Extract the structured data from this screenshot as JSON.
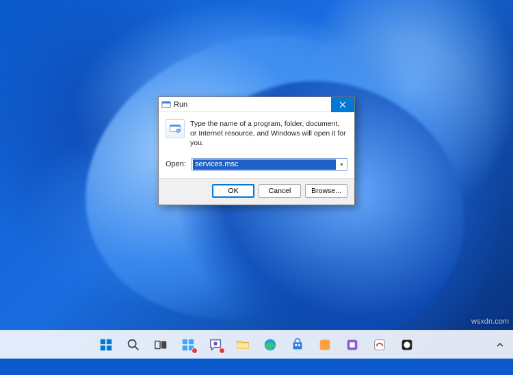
{
  "watermark": "wsxdn.com",
  "run_dialog": {
    "title": "Run",
    "description": "Type the name of a program, folder, document, or Internet resource, and Windows will open it for you.",
    "open_label": "Open:",
    "input_value": "services.msc",
    "buttons": {
      "ok": "OK",
      "cancel": "Cancel",
      "browse": "Browse..."
    }
  },
  "taskbar": {
    "items": [
      {
        "name": "start",
        "icon": "windows"
      },
      {
        "name": "search",
        "icon": "search"
      },
      {
        "name": "task-view",
        "icon": "taskview"
      },
      {
        "name": "widgets",
        "icon": "widgets",
        "badge": true
      },
      {
        "name": "chat",
        "icon": "chat",
        "badge": true
      },
      {
        "name": "file-explorer",
        "icon": "folder"
      },
      {
        "name": "edge",
        "icon": "edge"
      },
      {
        "name": "store",
        "icon": "store"
      },
      {
        "name": "app-1",
        "icon": "generic1"
      },
      {
        "name": "app-2",
        "icon": "generic2"
      },
      {
        "name": "app-3",
        "icon": "generic3"
      },
      {
        "name": "app-4",
        "icon": "generic4"
      }
    ]
  }
}
